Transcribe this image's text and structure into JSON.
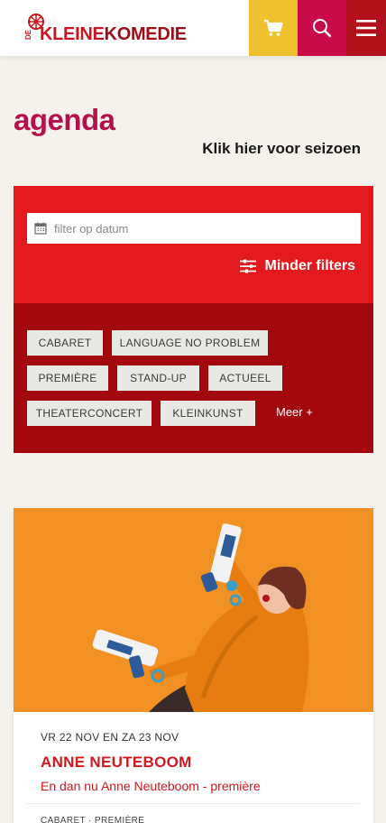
{
  "header": {
    "logo": {
      "prefix": "DE",
      "word1": "KLEINE",
      "word2": "KOMEDIE"
    },
    "icons": {
      "cart": "shopping-cart-icon",
      "search": "search-icon",
      "menu": "hamburger-menu-icon"
    },
    "colors": {
      "cart": "#efc12f",
      "search": "#c80b48",
      "menu": "#b3101d",
      "brand": "#c8161e"
    }
  },
  "page": {
    "title": "agenda",
    "season_link": "Klik hier voor seizoen"
  },
  "filters": {
    "date_placeholder": "filter op datum",
    "less_filters": "Minder filters",
    "tags": [
      "CABARET",
      "LANGUAGE NO PROBLEM",
      "PREMIÈRE",
      "STAND-UP",
      "ACTUEEL",
      "THEATERCONCERT",
      "KLEINKUNST"
    ],
    "more": "Meer +",
    "colors": {
      "top": "#e4191d",
      "bottom": "#a3080f"
    }
  },
  "events": [
    {
      "date": "VR 22 NOV EN ZA 23 NOV",
      "title": "ANNE NEUTEBOOM",
      "subtitle_main": "En dan nu Anne Neuteboom",
      "subtitle_sep": " - ",
      "subtitle_tag": "première",
      "categories": "CABARET · PREMIÈRE"
    }
  ]
}
